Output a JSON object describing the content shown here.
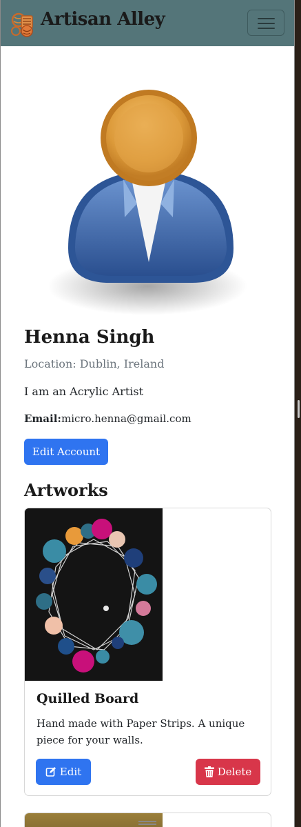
{
  "header": {
    "brand": "Artisan Alley",
    "logo_icon": "artisan-logo-icon",
    "menu_icon": "hamburger-menu-icon"
  },
  "profile": {
    "avatar_icon": "user-avatar-icon",
    "name": "Henna Singh",
    "location": "Location: Dublin, Ireland",
    "bio": "I am an Acrylic Artist",
    "email_label": "Email:",
    "email": "micro.henna@gmail.com",
    "edit_account_label": "Edit Account"
  },
  "artworks": {
    "title": "Artworks",
    "items": [
      {
        "title": "Quilled Board",
        "description": "Hand made with Paper Strips. A unique piece for your walls.",
        "edit_label": "Edit",
        "delete_label": "Delete",
        "edit_icon": "edit-icon",
        "delete_icon": "trash-icon"
      }
    ]
  },
  "colors": {
    "navbar": "#547579",
    "primary": "#2f74f0",
    "danger": "#d8364a"
  }
}
